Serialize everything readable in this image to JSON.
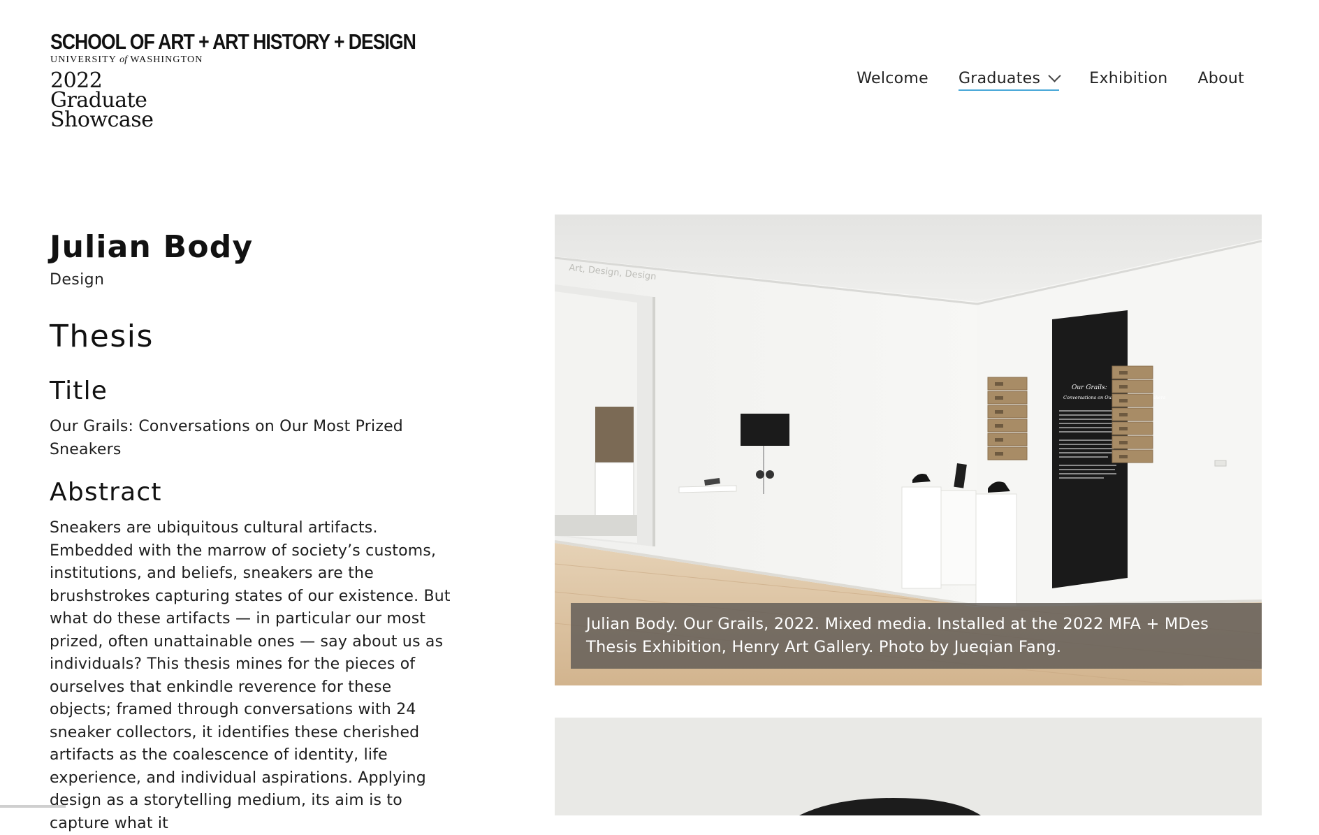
{
  "logo": {
    "school": "SCHOOL OF ART + ART HISTORY + DESIGN",
    "university_pre": "UNIVERSITY",
    "university_of": "of",
    "university_post": "WASHINGTON",
    "showcase_line1": "2022",
    "showcase_line2": "Graduate",
    "showcase_line3": "Showcase"
  },
  "nav": {
    "items": [
      {
        "label": "Welcome"
      },
      {
        "label": "Graduates",
        "active": true
      },
      {
        "label": "Exhibition"
      },
      {
        "label": "About"
      }
    ]
  },
  "colors": {
    "accent_underline": "#4aa8d8",
    "caption_bg": "#5f5a55",
    "panel_black": "#1a1a1a",
    "box_kraft": "#a88c66",
    "floor": "#d8bf9e"
  },
  "profile": {
    "name": "Julian Body",
    "department": "Design"
  },
  "thesis": {
    "heading": "Thesis",
    "title_heading": "Title",
    "title": "Our Grails: Conversations on Our Most Prized Sneakers",
    "abstract_heading": "Abstract",
    "abstract": "Sneakers are ubiquitous cultural artifacts. Embedded with the marrow of society’s customs, institutions, and beliefs, sneakers are the brushstrokes capturing states of our existence. But what do these artifacts — in particular our most prized, often unattainable ones — say about us as individuals? This thesis mines for the pieces of ourselves that enkindle reverence for these objects; framed through conversations with 24 sneaker collectors, it identifies these cherished artifacts as the coalescence of identity, life experience, and individual aspirations. Applying design as a storytelling medium, its aim is to capture what it"
  },
  "figure": {
    "caption": "Julian Body. Our Grails, 2022. Mixed media. Installed at the 2022 MFA + MDes Thesis Exhibition, Henry Art Gallery. Photo by Jueqian Fang.",
    "panel_heading": "Our Grails:",
    "panel_subheading": "Conversations on Our Most Prized Sneakers",
    "wall_text": "Art, Design, Design",
    "image_icon": "gallery-installation-photo"
  },
  "figure2": {
    "image_icon": "sneaker-detail-photo"
  }
}
